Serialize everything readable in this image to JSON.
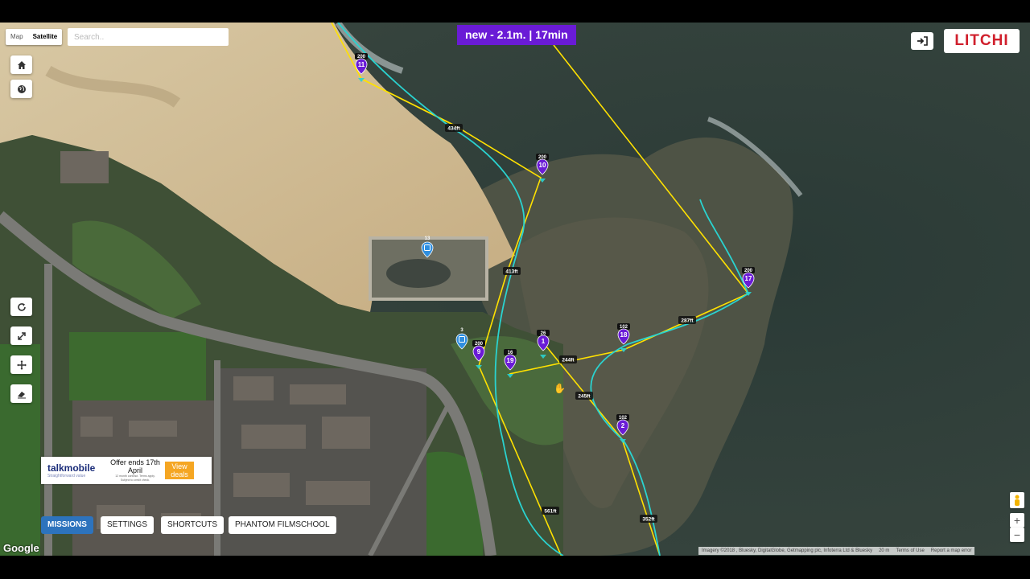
{
  "map": {
    "type_options": [
      "Map",
      "Satellite"
    ],
    "selected_type": "Satellite",
    "search_placeholder": "Search..",
    "google_logo": "Google",
    "attribution": "Imagery ©2018 , Bluesky, DigitalGlobe, Getmapping plc, Infoterra Ltd & Bluesky",
    "scale": "20 m",
    "terms": "Terms of Use",
    "report": "Report a map error"
  },
  "mission_banner": "new - 2.1m. | 17min",
  "brand": {
    "logo_text": "LITCHI",
    "accent": "#d0202d"
  },
  "colors": {
    "banner": "#6a1bd6",
    "path": "#ffe100",
    "curve": "#2ad3d0",
    "waypoint": "#6a1bd6",
    "poi": "#2f8fe0",
    "active_tab": "#2d73bd"
  },
  "left_tools": [
    {
      "name": "home-icon"
    },
    {
      "name": "globe-icon"
    },
    {
      "name": "refresh-icon"
    },
    {
      "name": "expand-icon"
    },
    {
      "name": "move-icon"
    },
    {
      "name": "eraser-icon"
    }
  ],
  "bottom_tabs": [
    "MISSIONS",
    "SETTINGS",
    "SHORTCUTS",
    "PHANTOM FILMSCHOOL"
  ],
  "ad": {
    "brand": "talkmobile",
    "tagline": "Straightforward value",
    "offer": "Offer ends 17th April",
    "fineprint": "12 month contract. Terms apply. Subject to credit check.",
    "cta": "View deals"
  },
  "waypoints": [
    {
      "n": "11",
      "alt": "200"
    },
    {
      "n": "10",
      "alt": "200"
    },
    {
      "n": "17",
      "alt": "200"
    },
    {
      "n": "18",
      "alt": "102"
    },
    {
      "n": "9",
      "alt": "200"
    },
    {
      "n": "1",
      "alt": "26"
    },
    {
      "n": "19",
      "alt": "16"
    },
    {
      "n": "2",
      "alt": "102"
    }
  ],
  "pois": [
    {
      "n": "13"
    },
    {
      "n": "3"
    }
  ],
  "distances": [
    "434ft",
    "413ft",
    "287ft",
    "244ft",
    "245ft",
    "561ft",
    "352ft"
  ]
}
